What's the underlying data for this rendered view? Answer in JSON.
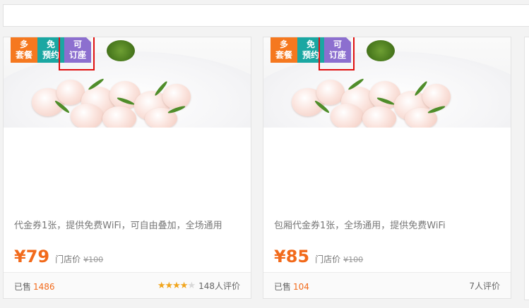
{
  "badges": {
    "multi": [
      "多",
      "套餐"
    ],
    "free": [
      "免",
      "预约"
    ],
    "seat": [
      "可",
      "订座"
    ]
  },
  "cards": [
    {
      "description": "代金券1张，提供免费WiFi，可自由叠加，全场通用",
      "price": "¥79",
      "store_price_label": "门店价",
      "original_price": "¥100",
      "sold_label": "已售",
      "sold_count": "1486",
      "rating_stars": 4.5,
      "review_count": "148人评价"
    },
    {
      "description": "包厢代金券1张，全场通用，提供免费WiFi",
      "price": "¥85",
      "store_price_label": "门店价",
      "original_price": "¥100",
      "sold_label": "已售",
      "sold_count": "104",
      "review_count": "7人评价"
    }
  ],
  "colors": {
    "accent": "#f26a1b",
    "badge_orange": "#f5781f",
    "badge_teal": "#1aa7a2",
    "badge_purple": "#8c6fcf",
    "highlight": "#e01010"
  }
}
